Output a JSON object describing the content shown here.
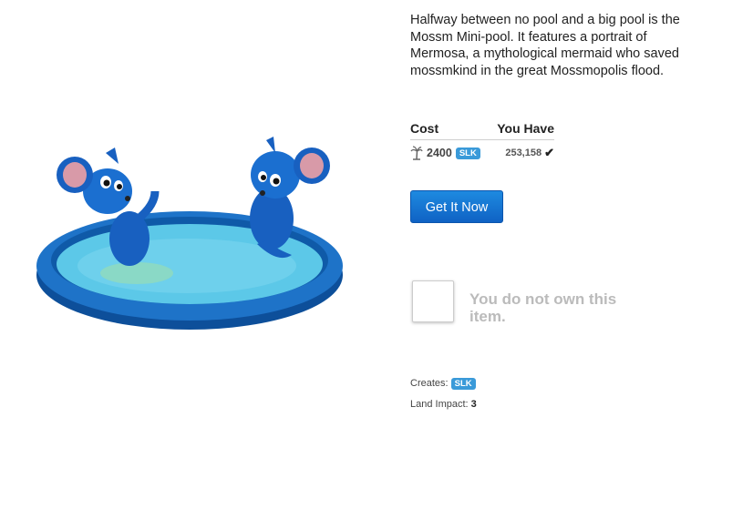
{
  "item": {
    "description": "Halfway between no pool and a big pool is the Mossm Mini-pool. It features a portrait of Mermosa, a mythological mermaid who saved mossmkind in the great Mossmopolis flood."
  },
  "pricing": {
    "cost_header": "Cost",
    "have_header": "You Have",
    "cost_value": "2400",
    "currency": "SLK",
    "have_value": "253,158",
    "currency_icon": "palm-tree-icon",
    "have_icon": "checkmark-icon"
  },
  "actions": {
    "buy_label": "Get It Now"
  },
  "ownership": {
    "message": "You do not own this item."
  },
  "details": {
    "creates_label": "Creates:",
    "creates_currency": "SLK",
    "land_label": "Land Impact:",
    "land_value": "3"
  },
  "colors": {
    "accent": "#1474d4",
    "tag": "#3a9ad9",
    "pool": "#1e73c8",
    "water": "#5cc8e8",
    "muted": "#bbbbbb"
  }
}
